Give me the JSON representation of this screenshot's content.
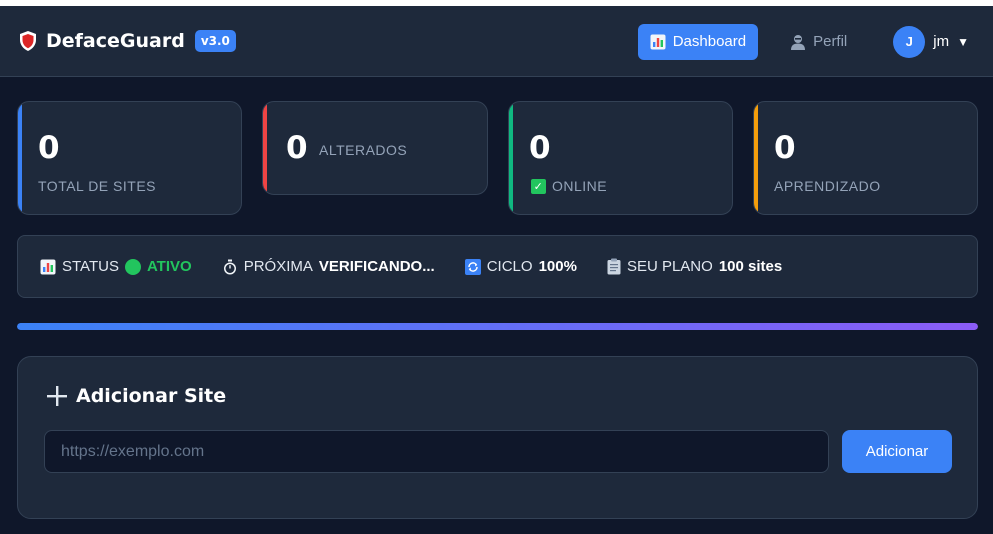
{
  "header": {
    "brand": "DefaceGuard",
    "version": "v3.0",
    "nav": [
      {
        "label": "Dashboard",
        "icon": "bar-chart-icon",
        "active": true
      },
      {
        "label": "Perfil",
        "icon": "user-icon",
        "active": false
      }
    ],
    "user": {
      "initial": "J",
      "name": "jm",
      "caret": "▼"
    }
  },
  "stats": [
    {
      "value": "0",
      "label": "TOTAL DE SITES",
      "accent": "#3b82f6"
    },
    {
      "value": "0",
      "label": "ALTERADOS",
      "accent": "#ef4444"
    },
    {
      "value": "0",
      "label": "ONLINE",
      "accent": "#10b981",
      "icon": "check-icon"
    },
    {
      "value": "0",
      "label": "APRENDIZADO",
      "accent": "#f59e0b"
    }
  ],
  "status_bar": {
    "status_label": "STATUS",
    "status_value": "ATIVO",
    "next_label": "PRÓXIMA",
    "next_value": "VERIFICANDO...",
    "cycle_label": "CICLO",
    "cycle_value": "100%",
    "plan_label": "SEU PLANO",
    "plan_value": "100 sites"
  },
  "progress": {
    "fraction": 1.0
  },
  "add_site": {
    "title": "Adicionar Site",
    "placeholder": "https://exemplo.com",
    "value": "",
    "button_label": "Adicionar"
  },
  "colors": {
    "background": "#0f172a",
    "card": "#1e293b",
    "primary": "#3b82f6",
    "success": "#22c55e"
  }
}
